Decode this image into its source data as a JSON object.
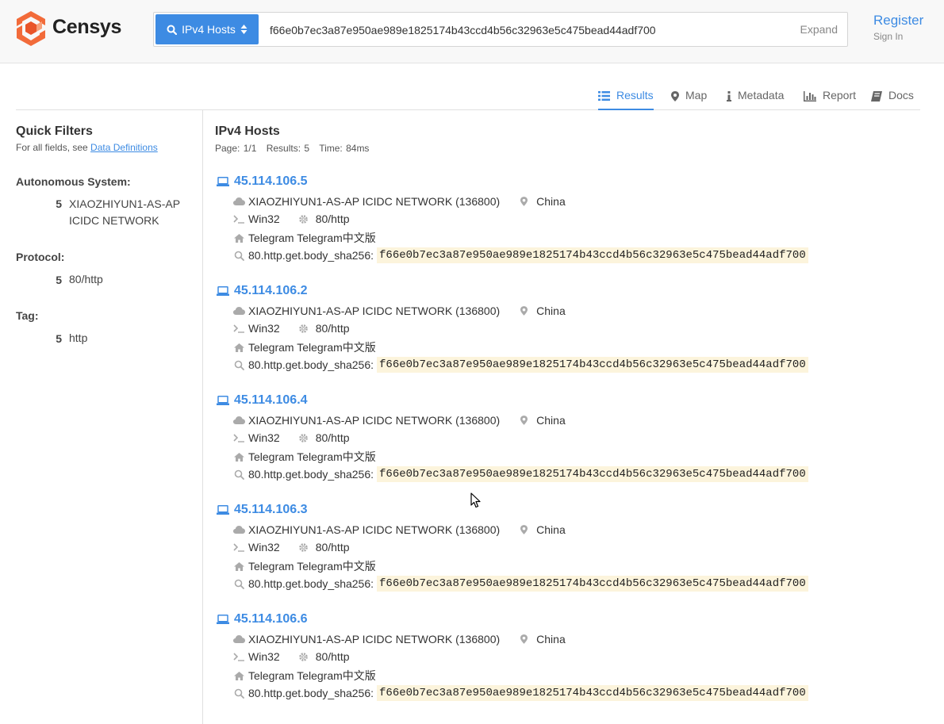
{
  "brand": {
    "name": "Censys",
    "accent": "#3d8be3",
    "logo_color": "#f26b3a"
  },
  "search": {
    "type_label": "IPv4 Hosts",
    "query": "f66e0b7ec3a87e950ae989e1825174b43ccd4b56c32963e5c475bead44adf700",
    "expand_label": "Expand"
  },
  "auth": {
    "register": "Register",
    "sign_in": "Sign In"
  },
  "tabs": [
    {
      "label": "Results",
      "icon": "list-icon",
      "active": true
    },
    {
      "label": "Map",
      "icon": "map-pin-icon"
    },
    {
      "label": "Metadata",
      "icon": "info-icon"
    },
    {
      "label": "Report",
      "icon": "bar-chart-icon"
    },
    {
      "label": "Docs",
      "icon": "book-icon"
    }
  ],
  "sidebar": {
    "title": "Quick Filters",
    "subtitle": "For all fields, see",
    "subtitle_link": "Data Definitions",
    "facets": [
      {
        "title": "Autonomous System:",
        "count": "5",
        "value": "XIAOZHIYUN1-AS-AP ICIDC NETWORK"
      },
      {
        "title": "Protocol:",
        "count": "5",
        "value": "80/http"
      },
      {
        "title": "Tag:",
        "count": "5",
        "value": "http"
      }
    ]
  },
  "results": {
    "title": "IPv4 Hosts",
    "page": "Page: 1/1",
    "count": "Results: 5",
    "time": "Time: 84ms",
    "items": [
      {
        "ip": "45.114.106.5",
        "as": "XIAOZHIYUN1-AS-AP ICIDC NETWORK (136800)",
        "country": "China",
        "os": "Win32",
        "protocol": "80/http",
        "title": "Telegram Telegram中文版",
        "field": "80.http.get.body_sha256:",
        "hash": "f66e0b7ec3a87e950ae989e1825174b43ccd4b56c32963e5c475bead44adf700"
      },
      {
        "ip": "45.114.106.2",
        "as": "XIAOZHIYUN1-AS-AP ICIDC NETWORK (136800)",
        "country": "China",
        "os": "Win32",
        "protocol": "80/http",
        "title": "Telegram Telegram中文版",
        "field": "80.http.get.body_sha256:",
        "hash": "f66e0b7ec3a87e950ae989e1825174b43ccd4b56c32963e5c475bead44adf700"
      },
      {
        "ip": "45.114.106.4",
        "as": "XIAOZHIYUN1-AS-AP ICIDC NETWORK (136800)",
        "country": "China",
        "os": "Win32",
        "protocol": "80/http",
        "title": "Telegram Telegram中文版",
        "field": "80.http.get.body_sha256:",
        "hash": "f66e0b7ec3a87e950ae989e1825174b43ccd4b56c32963e5c475bead44adf700"
      },
      {
        "ip": "45.114.106.3",
        "as": "XIAOZHIYUN1-AS-AP ICIDC NETWORK (136800)",
        "country": "China",
        "os": "Win32",
        "protocol": "80/http",
        "title": "Telegram Telegram中文版",
        "field": "80.http.get.body_sha256:",
        "hash": "f66e0b7ec3a87e950ae989e1825174b43ccd4b56c32963e5c475bead44adf700"
      },
      {
        "ip": "45.114.106.6",
        "as": "XIAOZHIYUN1-AS-AP ICIDC NETWORK (136800)",
        "country": "China",
        "os": "Win32",
        "protocol": "80/http",
        "title": "Telegram Telegram中文版",
        "field": "80.http.get.body_sha256:",
        "hash": "f66e0b7ec3a87e950ae989e1825174b43ccd4b56c32963e5c475bead44adf700"
      }
    ]
  }
}
